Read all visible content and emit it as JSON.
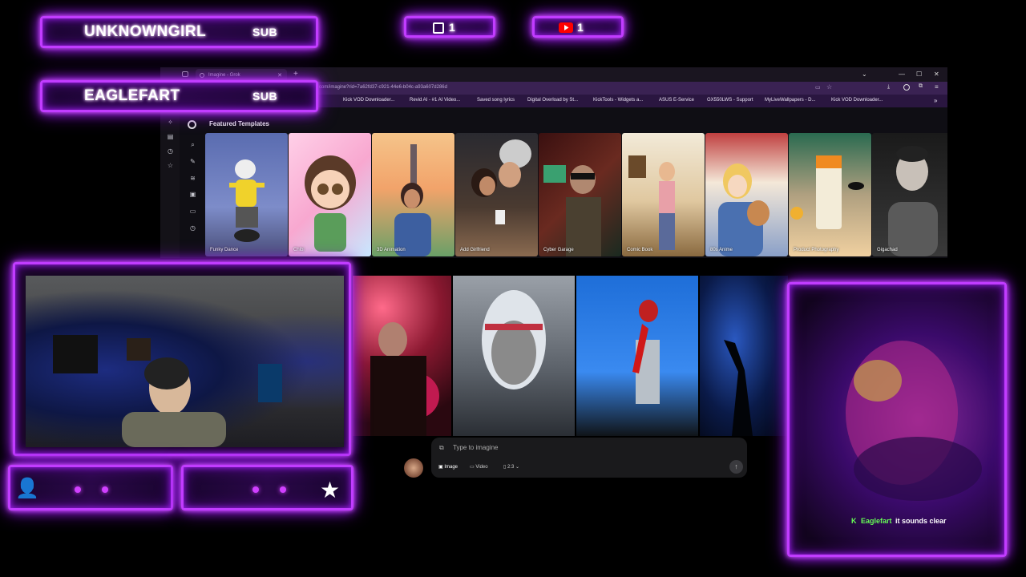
{
  "subs": [
    {
      "name": "UNKNOWNGIRL",
      "tag": "SUB"
    },
    {
      "name": "EAGLEFART",
      "tag": "SUB"
    }
  ],
  "counters": [
    {
      "platform": "twitch-icon",
      "count": "1"
    },
    {
      "platform": "youtube-icon",
      "count": "1"
    }
  ],
  "browser": {
    "tab_title": "Imagine - Grok",
    "url": "com/imagine?rid=7a62fd37-c921-44e6-b04c-a93a607d286d",
    "bookmarks": [
      "Kick VOD Downloader...",
      "Revid AI - #1 AI Video...",
      "Saved song lyrics",
      "Digital Overload by St...",
      "KickTools - Widgets a...",
      "ASUS E-Service",
      "GX550LWS - Support",
      "MyLiveWallpapers - D...",
      "Kick VOD Downloader..."
    ],
    "section_title": "Featured Templates",
    "templates": [
      "Funky Dance",
      "Chibi",
      "3D Animation",
      "Add Girlfriend",
      "Cyber Garage",
      "Comic Book",
      "80s Anime",
      "Product Photography",
      "Gigachad"
    ]
  },
  "prompt": {
    "placeholder": "Type to imagine",
    "mode_image": "Image",
    "mode_video": "Video",
    "ratio": "2:3"
  },
  "chat": {
    "user": "Eaglefart",
    "message": "it sounds clear"
  },
  "colors": {
    "neon": "#c13cff",
    "chat_user": "#66ff55"
  }
}
